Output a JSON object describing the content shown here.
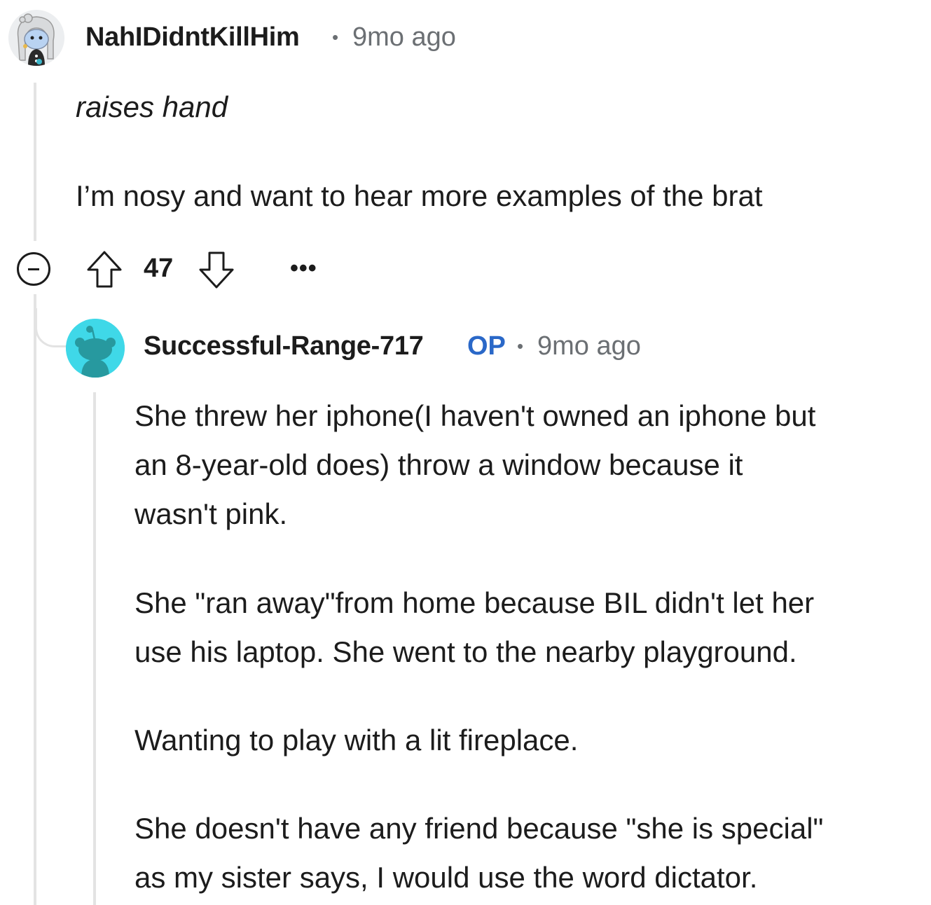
{
  "parent_comment": {
    "username": "NahIDidntKillHim",
    "separator": "•",
    "time": "9mo ago",
    "italic_line": "raises hand",
    "body_line": "I’m nosy and want to hear more examples of the brat",
    "votes": "47",
    "more": "•••"
  },
  "reply_comment": {
    "username": "Successful-Range-717",
    "op_badge": "OP",
    "separator": "•",
    "time": "9mo ago",
    "paragraphs": [
      [
        "She threw her iphone(I haven't owned an iphone but",
        "an 8-year-old does) throw a window because it",
        "wasn't pink."
      ],
      [
        "She \"ran away\"from home because BIL didn't let her",
        "use his laptop. She went to the nearby playground."
      ],
      [
        "Wanting to play with a lit fireplace."
      ],
      [
        "She doesn't have any friend because \"she is special\"",
        "as my sister says, I would use the word dictator."
      ]
    ]
  },
  "colors": {
    "text": "#1c1c1c",
    "muted": "#6b6f73",
    "op_blue": "#2a68c8",
    "thread_line": "#e3e3e3",
    "reply_avatar_bg": "#3fd8e8"
  }
}
